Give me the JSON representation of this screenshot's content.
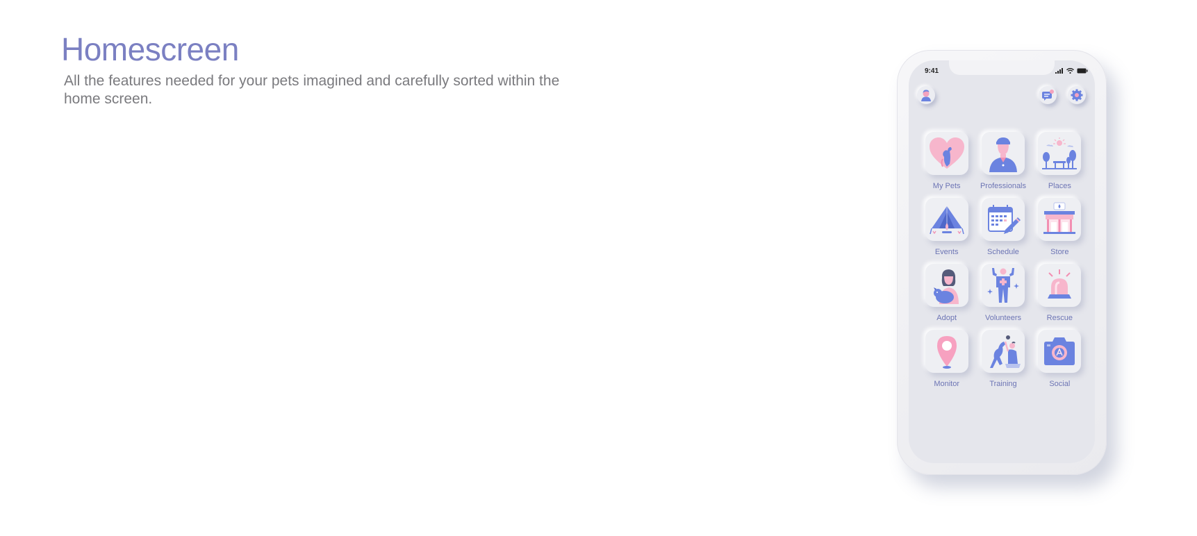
{
  "header": {
    "title": "Homescreen",
    "subtitle": "All the features needed for your pets imagined and carefully sorted within the home screen."
  },
  "phone": {
    "status_time": "9:41",
    "top_bar": {
      "avatar_icon": "user-avatar-icon",
      "messages_icon": "chat-bubble-icon",
      "settings_icon": "gear-icon"
    },
    "tiles": [
      {
        "label": "My Pets",
        "icon": "heart-pet-icon"
      },
      {
        "label": "Professionals",
        "icon": "veterinarian-icon"
      },
      {
        "label": "Places",
        "icon": "park-icon"
      },
      {
        "label": "Events",
        "icon": "tent-campfire-icon"
      },
      {
        "label": "Schedule",
        "icon": "calendar-pencil-icon"
      },
      {
        "label": "Store",
        "icon": "storefront-icon"
      },
      {
        "label": "Adopt",
        "icon": "girl-with-dog-icon"
      },
      {
        "label": "Volunteers",
        "icon": "volunteer-person-icon"
      },
      {
        "label": "Rescue",
        "icon": "siren-icon"
      },
      {
        "label": "Monitor",
        "icon": "location-pin-icon"
      },
      {
        "label": "Training",
        "icon": "dog-training-icon"
      },
      {
        "label": "Social",
        "icon": "camera-icon"
      }
    ]
  },
  "colors": {
    "accent_blue": "#6b83e0",
    "accent_pink": "#f4a3bf",
    "title": "#7b80c2",
    "screen_bg": "#e5e6ec"
  }
}
